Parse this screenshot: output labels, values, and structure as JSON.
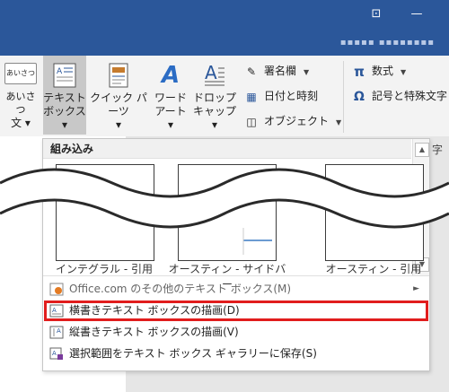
{
  "titlebar": {
    "ribbon_icon": "⊡",
    "minimize": "—",
    "account": "▪▪▪▪▪ ▪▪▪▪▪▪▪▪"
  },
  "ribbon": {
    "greeting": {
      "line1": "あいさつ",
      "line2": "文 ▾",
      "icon_text": "あいさつ"
    },
    "textbox": {
      "line1": "テキスト",
      "line2": "ボックス ▾"
    },
    "quickparts": {
      "line1": "クイック パーツ",
      "line2": "▾"
    },
    "wordart": {
      "line1": "ワード",
      "line2": "アート ▾"
    },
    "dropcap": {
      "line1": "ドロップ",
      "line2": "キャップ ▾"
    },
    "signature": "署名欄",
    "datetime": "日付と時刻",
    "object": "オブジェクト",
    "equation": "数式",
    "symbol": "記号と特殊文字"
  },
  "panel": {
    "header": "組み込み",
    "right_char": "字",
    "gallery": [
      {
        "label": "インテグラル - 引用"
      },
      {
        "label": "オースティン - サイドバー"
      },
      {
        "label": "オースティン - 引用"
      }
    ],
    "menu": [
      {
        "label": "Office.com のその他のテキスト ボックス(M)",
        "icon": "office-icon"
      },
      {
        "label": "横書きテキスト ボックスの描画(D)",
        "icon": "horizontal-textbox-icon"
      },
      {
        "label": "縦書きテキスト ボックスの描画(V)",
        "icon": "vertical-textbox-icon"
      },
      {
        "label": "選択範囲をテキスト ボックス ギャラリーに保存(S)",
        "icon": "save-gallery-icon"
      }
    ]
  },
  "colors": {
    "titlebar": "#2b579a",
    "highlight": "#e11d1d"
  }
}
